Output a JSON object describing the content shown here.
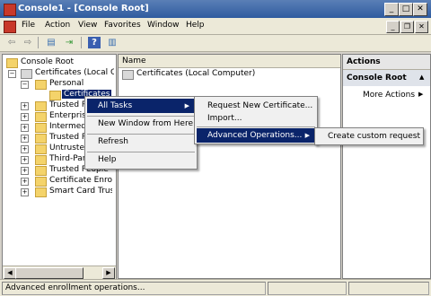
{
  "window": {
    "title": "Console1 - [Console Root]",
    "buttons": {
      "minimize": "_",
      "maximize": "□",
      "close": "✕"
    }
  },
  "menubar": {
    "items": [
      "File",
      "Action",
      "View",
      "Favorites",
      "Window",
      "Help"
    ],
    "mdi_buttons": {
      "minimize": "_",
      "restore": "❐",
      "close": "✕"
    }
  },
  "toolbar": {
    "icons": [
      "back-icon",
      "forward-icon",
      "show-hide-tree-icon",
      "export-list-icon",
      "help-icon",
      "show-hide-action-pane-icon"
    ]
  },
  "tree": {
    "items": [
      {
        "label": "Console Root"
      },
      {
        "label": "Certificates (Local Computer)"
      },
      {
        "label": "Personal"
      },
      {
        "label": "Certificates"
      },
      {
        "label": "Trusted Root Certification Authorities"
      },
      {
        "label": "Enterprise Trust"
      },
      {
        "label": "Intermediate Certification Authorities"
      },
      {
        "label": "Trusted Publishers"
      },
      {
        "label": "Untrusted Certificates"
      },
      {
        "label": "Third-Party Root Certification Authorities"
      },
      {
        "label": "Trusted People"
      },
      {
        "label": "Certificate Enrollment Requests"
      },
      {
        "label": "Smart Card Trusted Roots"
      }
    ]
  },
  "list": {
    "column_name": "Name",
    "rows": [
      "Certificates (Local Computer)"
    ]
  },
  "actions": {
    "header": "Actions",
    "section": "Console Root",
    "items": [
      "More Actions"
    ],
    "section_chevron": "▲",
    "item_chevron": "▶"
  },
  "context_menu": {
    "items": [
      {
        "label": "All Tasks",
        "has_submenu": true
      },
      {
        "label": "New Window from Here"
      },
      {
        "label": "Refresh"
      },
      {
        "label": "Help"
      }
    ],
    "submenu_arrow": "▶"
  },
  "all_tasks_submenu": {
    "items": [
      {
        "label": "Request New Certificate..."
      },
      {
        "label": "Import..."
      },
      {
        "label": "Advanced Operations...",
        "has_submenu": true
      }
    ]
  },
  "advanced_submenu": {
    "items": [
      {
        "label": "Create custom request"
      }
    ]
  },
  "statusbar": {
    "text": "Advanced enrollment operations..."
  },
  "scroll": {
    "left_arrow": "◀",
    "right_arrow": "▶"
  },
  "expander": {
    "plus": "+",
    "minus": "−"
  }
}
